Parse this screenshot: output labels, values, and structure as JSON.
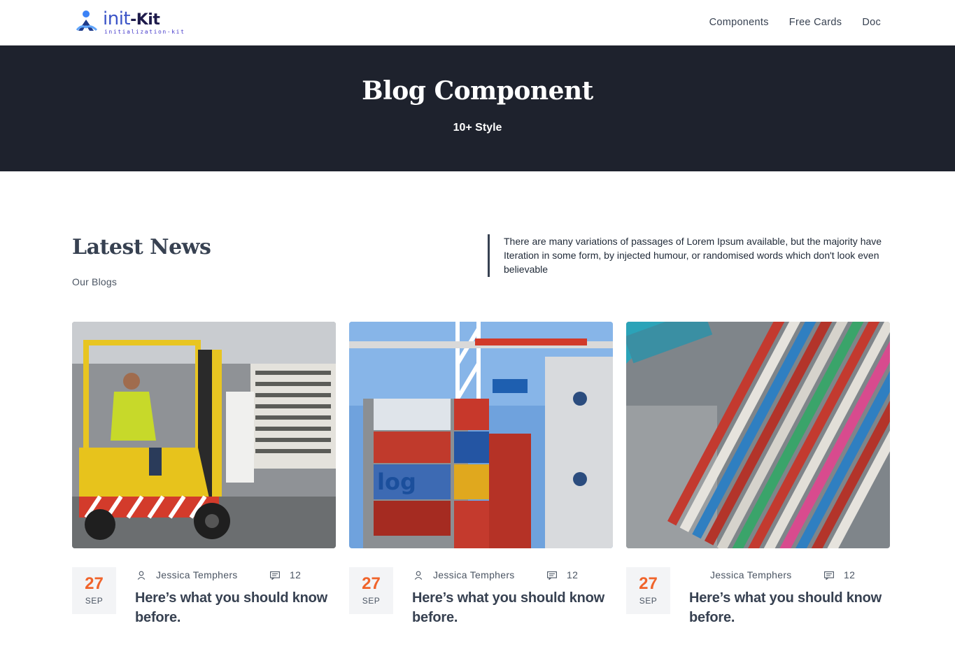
{
  "header": {
    "logo": {
      "name": "init-Kit",
      "brand_part1": "init",
      "brand_part2": "-Kit",
      "tagline": "initialization-kit"
    },
    "nav": [
      {
        "label": "Components"
      },
      {
        "label": "Free Cards"
      },
      {
        "label": "Doc"
      }
    ]
  },
  "hero": {
    "title": "Blog Component",
    "subtitle": "10+ Style",
    "background": "#1e222d"
  },
  "section": {
    "title": "Latest News",
    "subtitle": "Our Blogs",
    "description": "There are many variations of passages of Lorem Ipsum available, but the majority have Iteration in some form, by injected humour, or randomised words which don't look even believable"
  },
  "posts": [
    {
      "image": "warehouse-forklift-photo",
      "day": "27",
      "month": "SEP",
      "author": "Jessica Temphers",
      "comments": "12",
      "title": "Here’s what you should know before."
    },
    {
      "image": "port-containers-crane-photo",
      "day": "27",
      "month": "SEP",
      "author": "Jessica Temphers",
      "comments": "12",
      "title": "Here’s what you should know before."
    },
    {
      "image": "aerial-container-yard-photo",
      "day": "27",
      "month": "SEP",
      "author": "Jessica Temphers",
      "comments": "12",
      "title": "Here’s what you should know before."
    }
  ],
  "colors": {
    "accent": "#f0642b",
    "heading": "#374151",
    "hero_bg": "#1e222d",
    "date_bg": "#f3f4f6"
  }
}
